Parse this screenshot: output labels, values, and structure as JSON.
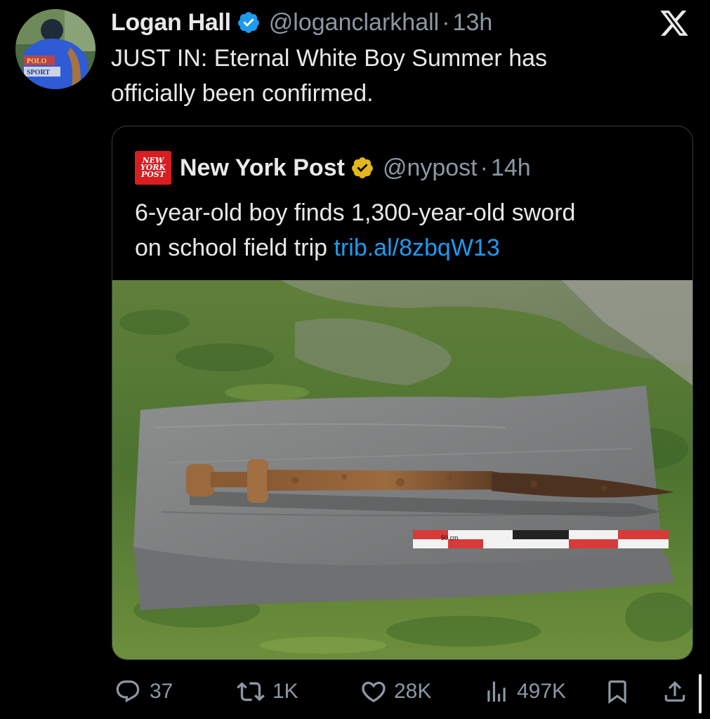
{
  "tweet": {
    "author_name": "Logan Hall",
    "handle": "@loganclarkhall",
    "separator": "·",
    "time": "13h",
    "text_line1": "JUST IN: Eternal White Boy Summer has",
    "text_line2": "officially been confirmed.",
    "avatar_text_1": "POLO",
    "avatar_text_2": "SPORT"
  },
  "quoted": {
    "logo_lines": [
      "NEW",
      "YORK",
      "POST"
    ],
    "author_name": "New York Post",
    "handle": "@nypost",
    "separator": "·",
    "time": "14h",
    "text_line1": "6-year-old boy finds 1,300-year-old sword",
    "text_line2_prefix": "on school field trip ",
    "link": "trib.al/8zbqW13",
    "scale_label": "50 cm"
  },
  "actions": {
    "replies": "37",
    "reposts": "1K",
    "likes": "28K",
    "views": "497K"
  },
  "colors": {
    "background": "#000000",
    "text": "#e7e9ea",
    "secondary": "#8b98a5",
    "link": "#1d9bf0",
    "verified_blue": "#1d9bf0",
    "verified_gold": "#e2b719",
    "nypost_red": "#d81e21"
  },
  "icons": [
    "verified-badge-icon",
    "x-logo-icon",
    "gold-verified-badge-icon",
    "reply-icon",
    "repost-icon",
    "like-icon",
    "views-icon",
    "bookmark-icon",
    "share-icon"
  ]
}
